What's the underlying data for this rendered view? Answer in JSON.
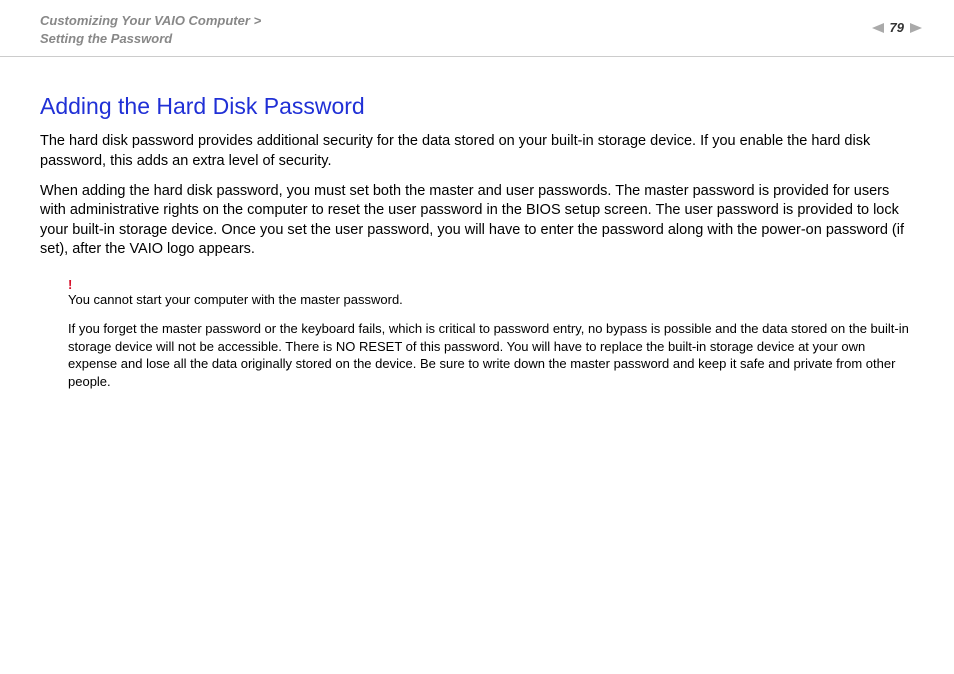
{
  "header": {
    "breadcrumb_line1": "Customizing Your VAIO Computer",
    "breadcrumb_sep": ">",
    "breadcrumb_line2": "Setting the Password",
    "page_number": "79"
  },
  "main": {
    "title": "Adding the Hard Disk Password",
    "p1": "The hard disk password provides additional security for the data stored on your built-in storage device. If you enable the hard disk password, this adds an extra level of security.",
    "p2": "When adding the hard disk password, you must set both the master and user passwords. The master password is provided for users with administrative rights on the computer to reset the user password in the BIOS setup screen. The user password is provided to lock your built-in storage device. Once you set the user password, you will have to enter the password along with the power-on password (if set), after the VAIO logo appears.",
    "bang": "!",
    "note1": "You cannot start your computer with the master password.",
    "note2": "If you forget the master password or the keyboard fails, which is critical to password entry, no bypass is possible and the data stored on the built-in storage device will not be accessible. There is NO RESET of this password. You will have to replace the built-in storage device at your own expense and lose all the data originally stored on the device. Be sure to write down the master password and keep it safe and private from other people."
  }
}
